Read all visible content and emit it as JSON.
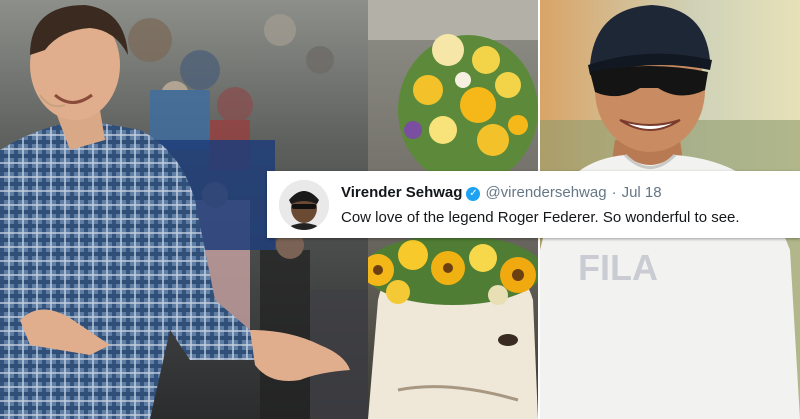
{
  "tweet": {
    "display_name": "Virender Sehwag",
    "handle": "@virendersehwag",
    "separator": "·",
    "date": "Jul 18",
    "text": "Cow love of the legend Roger Federer. So wonderful to see.",
    "verified_badge_color": "#1da1f2"
  },
  "photos": {
    "left": "man-in-plaid-shirt",
    "middle": "cow-with-flower-crown",
    "right": "man-in-cap-and-sunglasses"
  },
  "shirt_print": "FILA"
}
